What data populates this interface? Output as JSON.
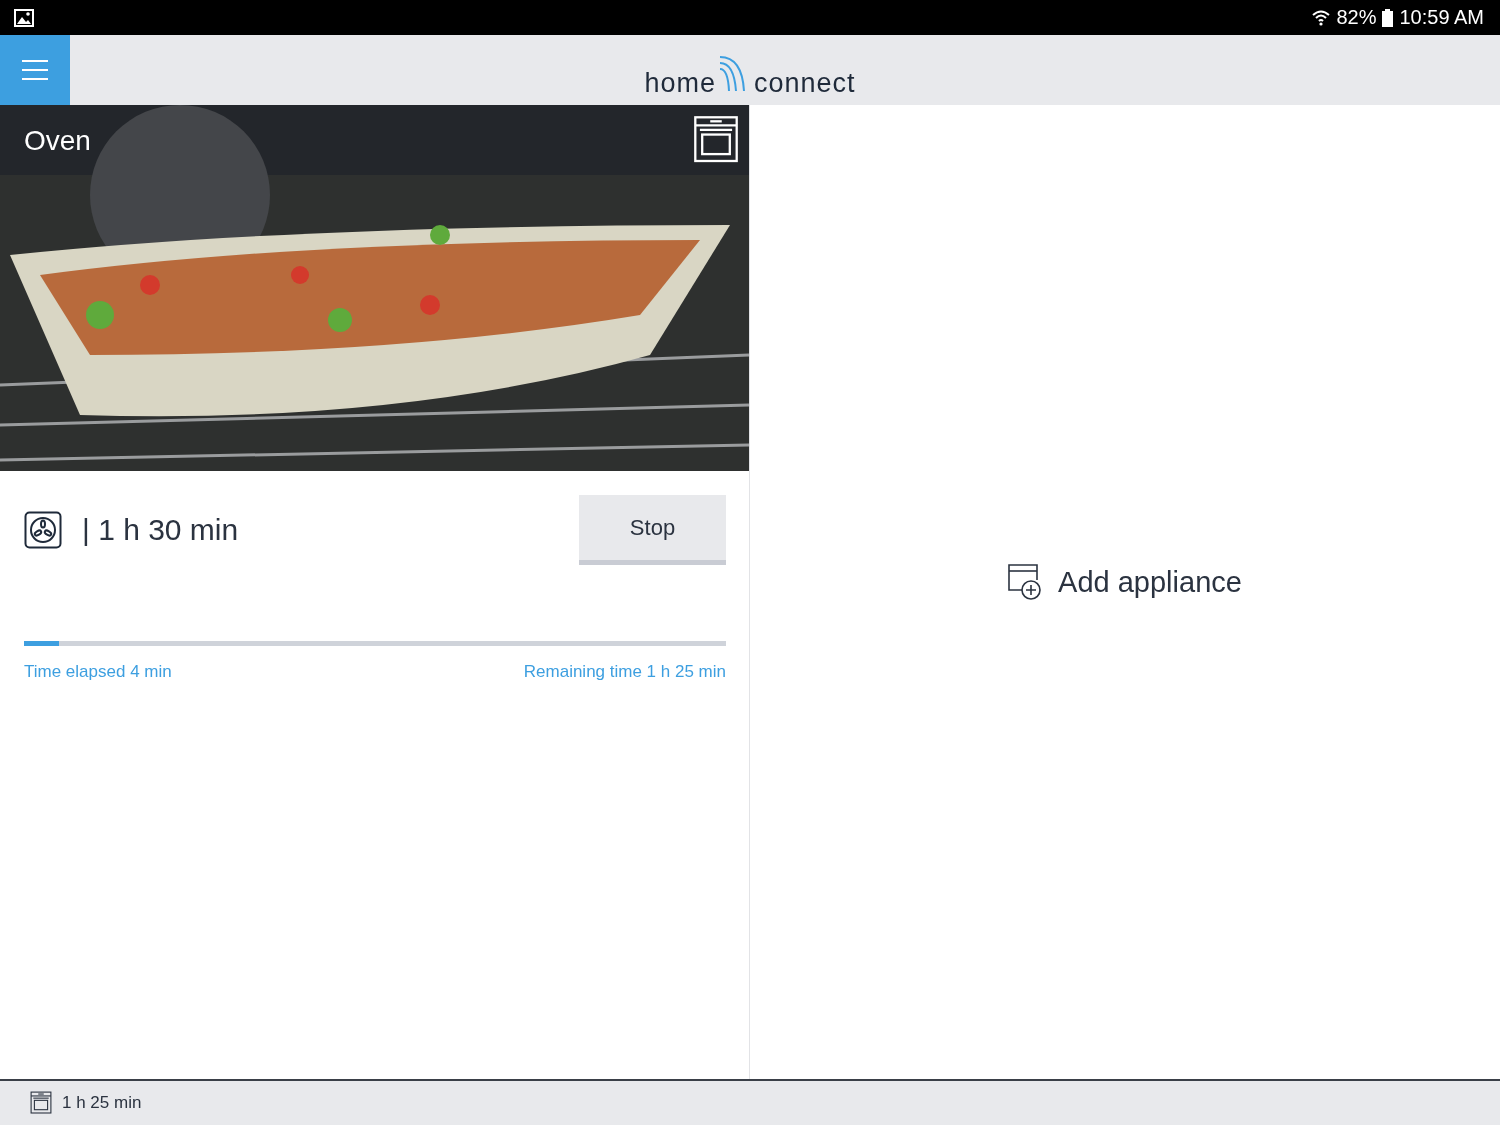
{
  "status_bar": {
    "battery": "82%",
    "time": "10:59 AM"
  },
  "header": {
    "logo_left": "home",
    "logo_right": "connect"
  },
  "appliance_card": {
    "title": "Oven",
    "duration": "| 1 h 30 min",
    "stop_button": "Stop",
    "progress": {
      "level": 0.05
    },
    "elapsed": "Time elapsed 4 min",
    "remaining": "Remaining time 1 h 25 min"
  },
  "add_appliance": {
    "label": "Add appliance"
  },
  "footer": {
    "time": "1 h 25 min"
  }
}
